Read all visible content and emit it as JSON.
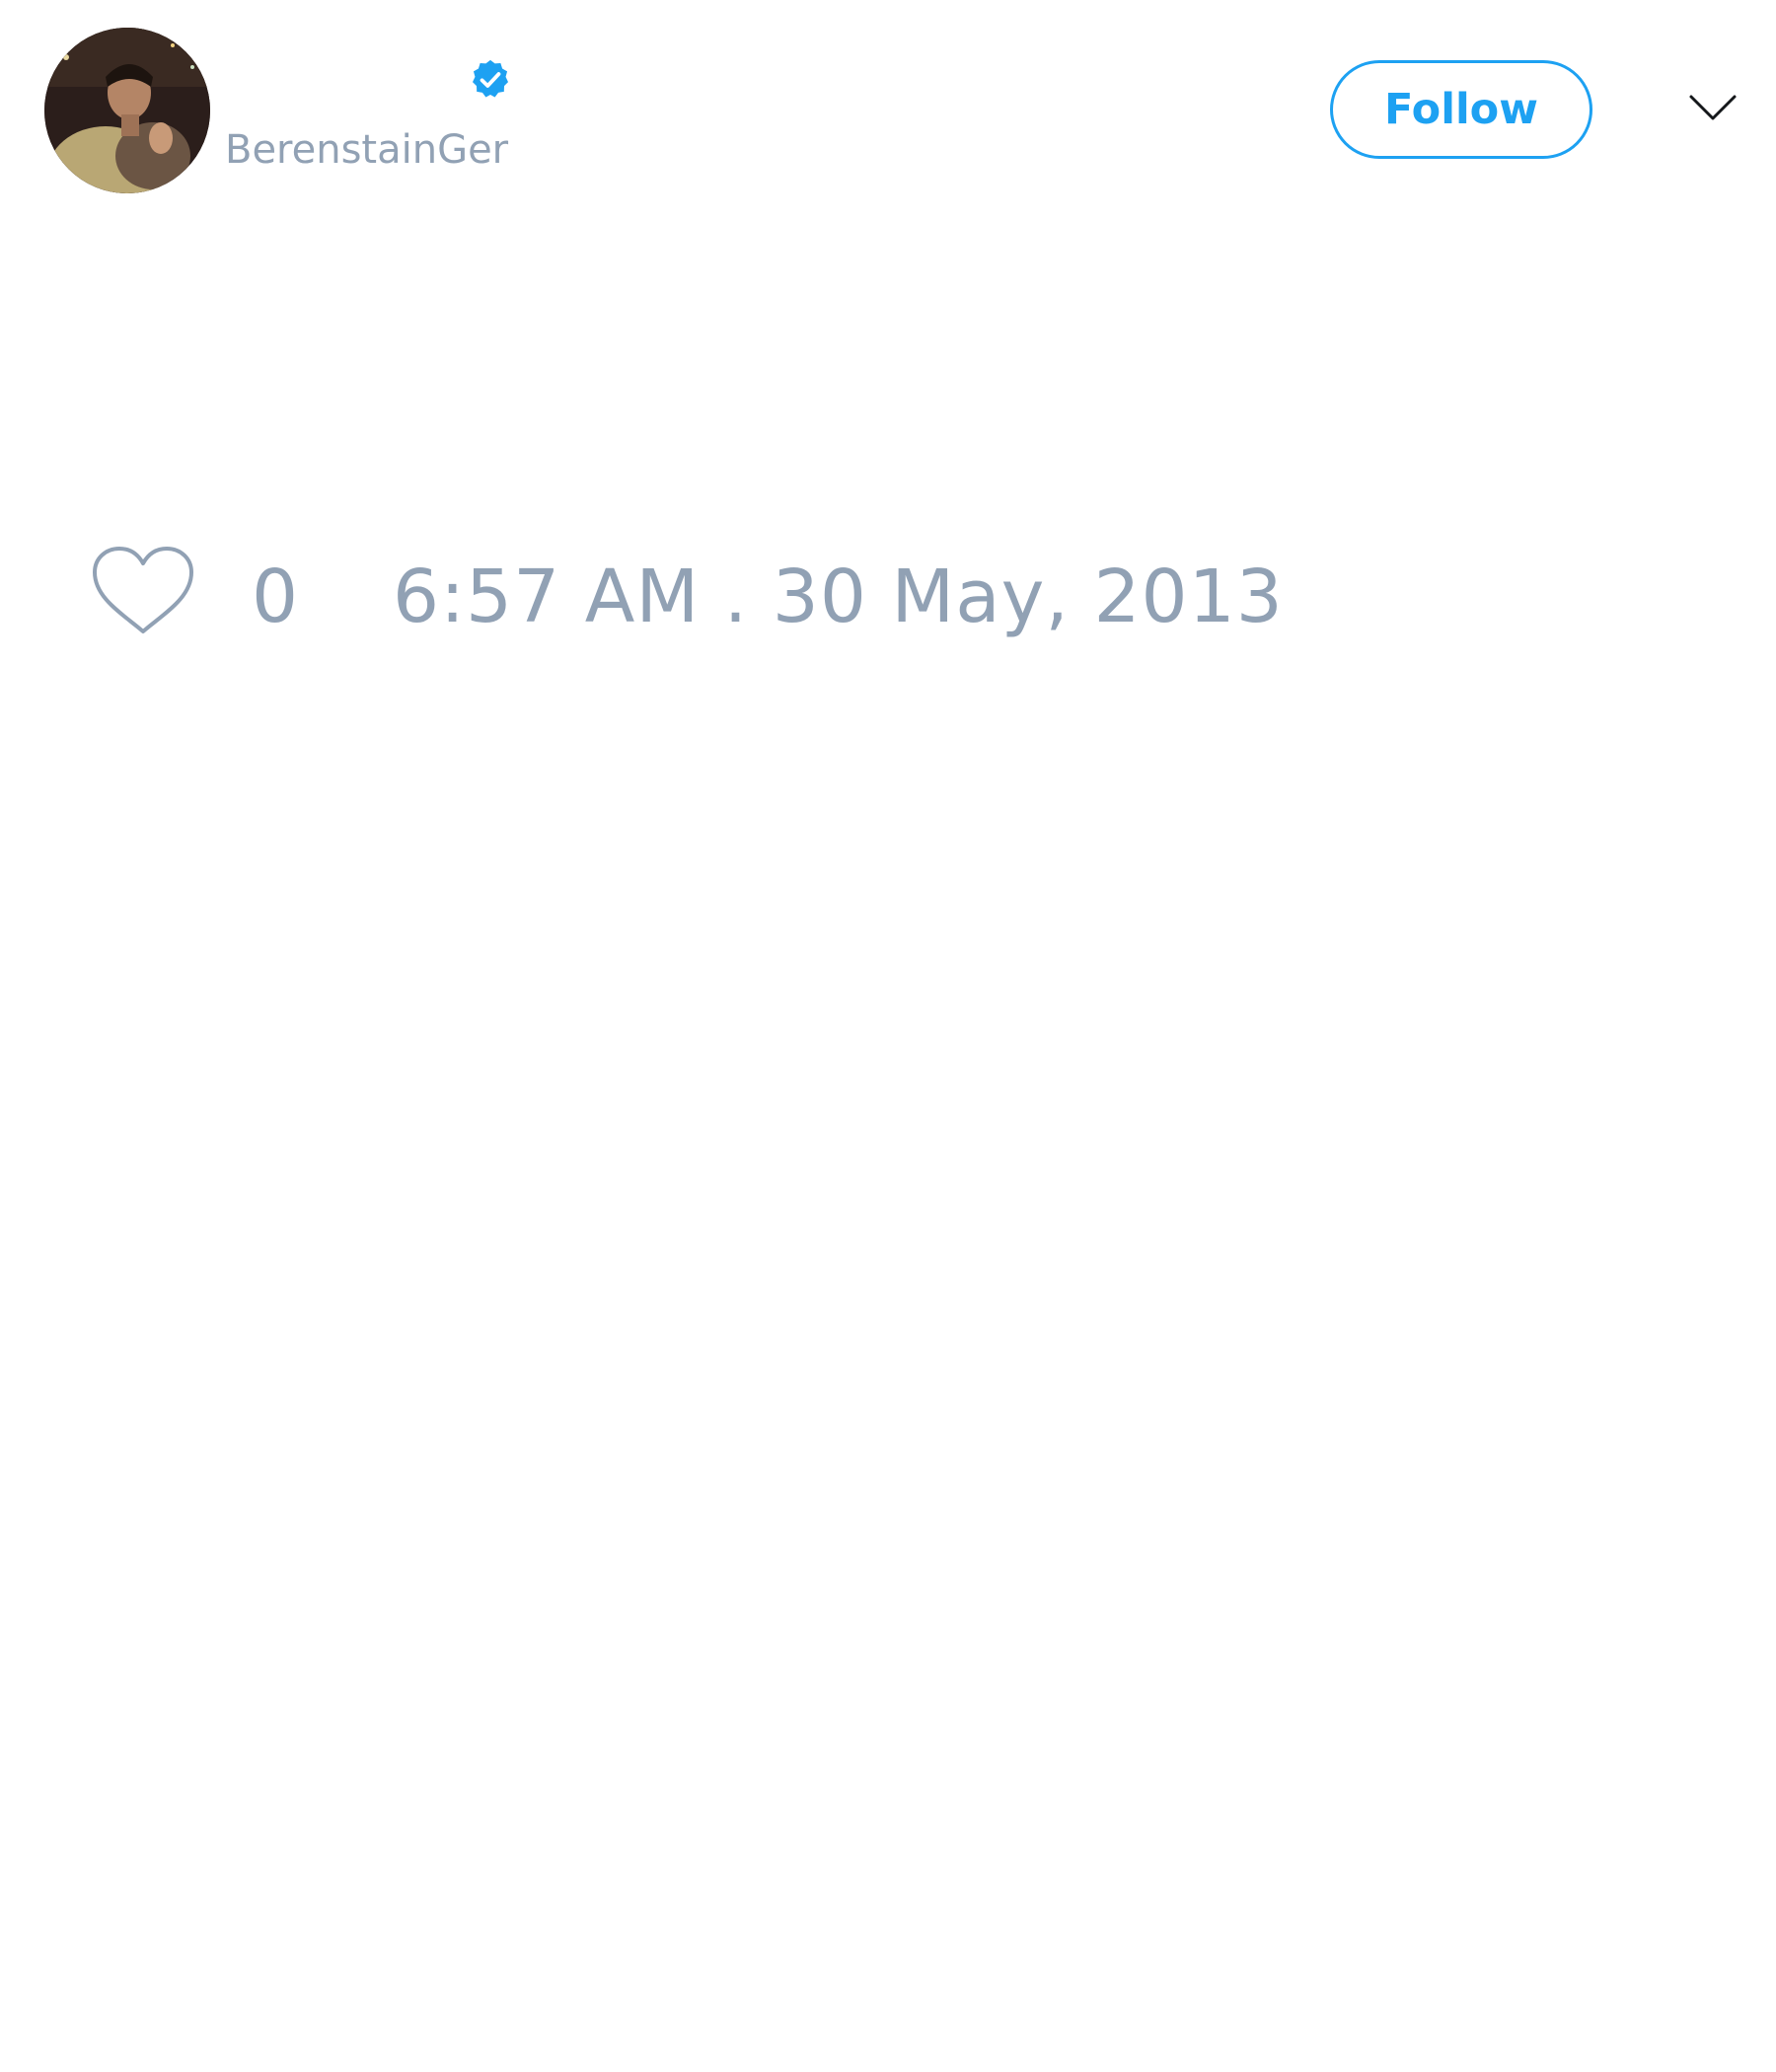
{
  "tweet": {
    "username": "BerenstainGer",
    "verified_icon": "verified-badge-icon",
    "follow_label": "Follow",
    "more_icon": "chevron-down-icon",
    "like_icon": "heart-icon",
    "like_count": "0",
    "timestamp": "6:57 AM . 30 May, 2013"
  },
  "colors": {
    "accent": "#1da1f2",
    "muted_text": "#91a1b4",
    "background": "#ffffff"
  }
}
